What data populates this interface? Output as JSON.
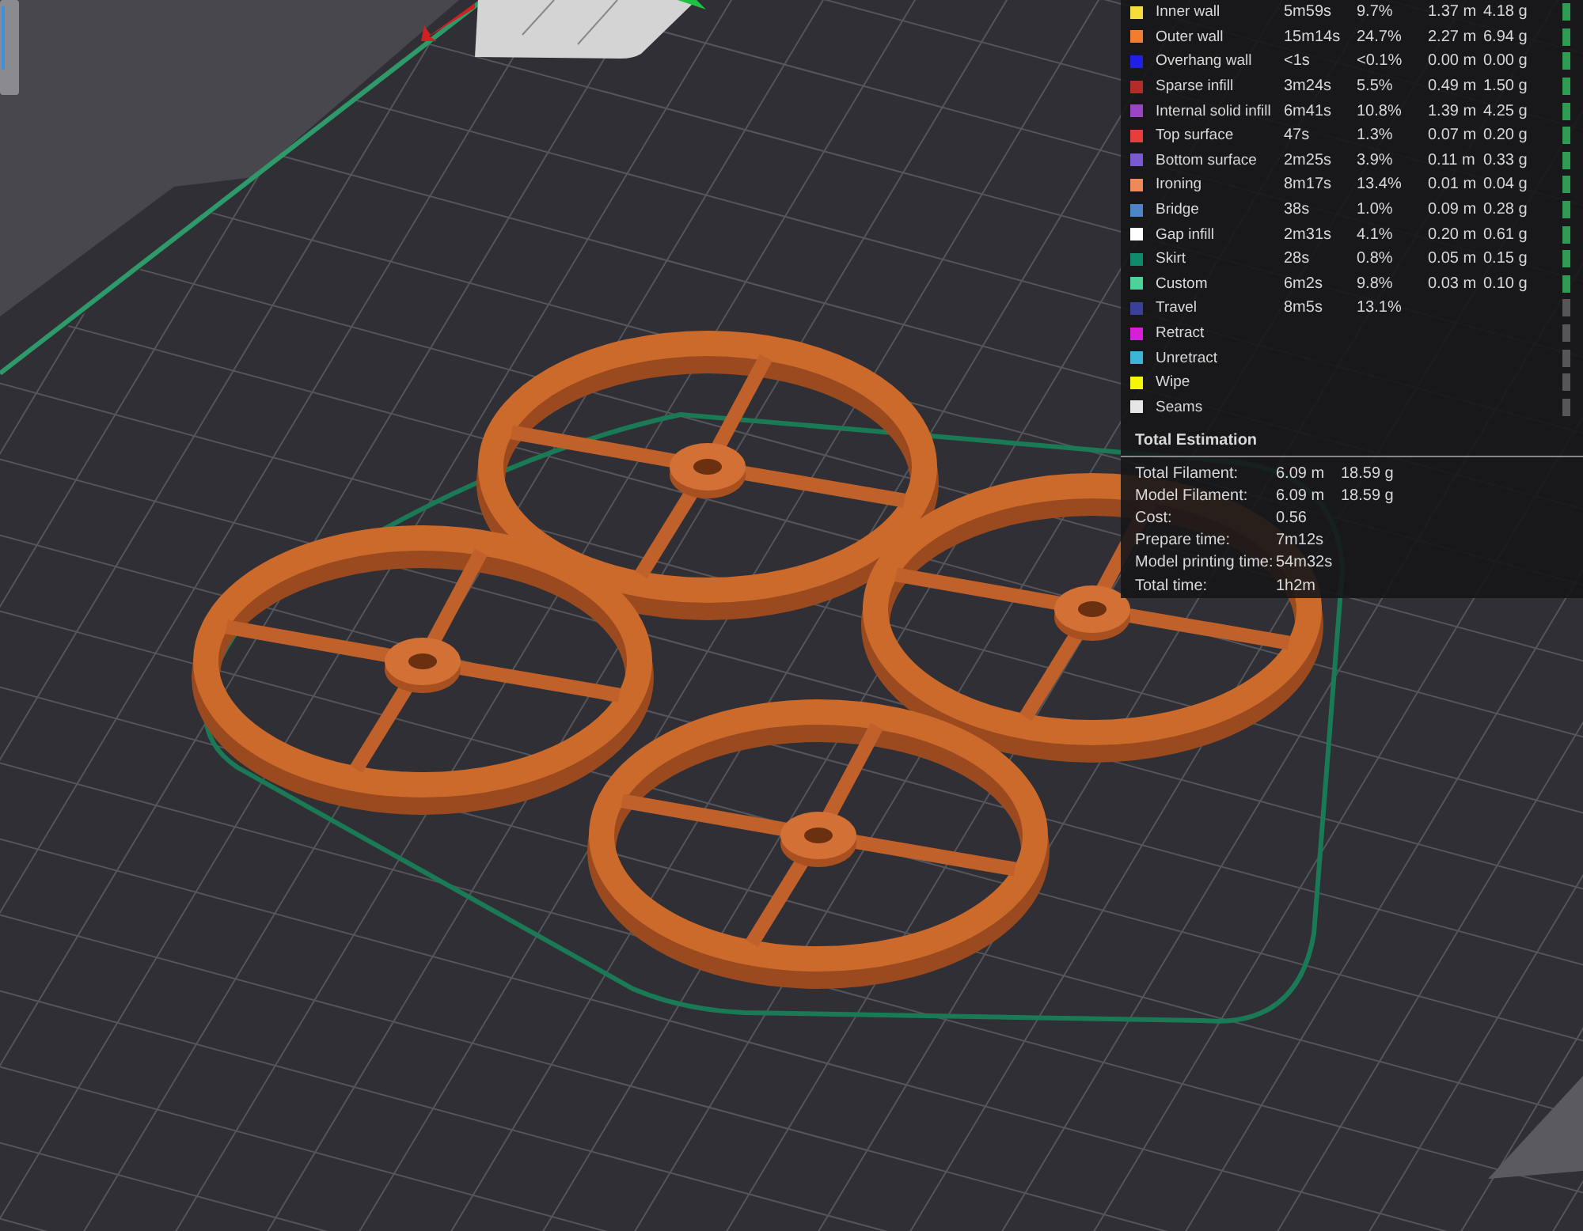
{
  "legend": {
    "rows": [
      {
        "name": "Inner wall",
        "color": "#f5dd3a",
        "time": "5m59s",
        "percent": "9.7%",
        "length": "1.37 m",
        "weight": "4.18 g",
        "checked": true
      },
      {
        "name": "Outer wall",
        "color": "#f07e30",
        "time": "15m14s",
        "percent": "24.7%",
        "length": "2.27 m",
        "weight": "6.94 g",
        "checked": true
      },
      {
        "name": "Overhang wall",
        "color": "#1f1fe8",
        "time": "<1s",
        "percent": "<0.1%",
        "length": "0.00 m",
        "weight": "0.00 g",
        "checked": true
      },
      {
        "name": "Sparse infill",
        "color": "#b02d2a",
        "time": "3m24s",
        "percent": "5.5%",
        "length": "0.49 m",
        "weight": "1.50 g",
        "checked": true
      },
      {
        "name": "Internal solid infill",
        "color": "#9b45c4",
        "time": "6m41s",
        "percent": "10.8%",
        "length": "1.39 m",
        "weight": "4.25 g",
        "checked": true
      },
      {
        "name": "Top surface",
        "color": "#e83d3d",
        "time": "47s",
        "percent": "1.3%",
        "length": "0.07 m",
        "weight": "0.20 g",
        "checked": true
      },
      {
        "name": "Bottom surface",
        "color": "#7a5ad2",
        "time": "2m25s",
        "percent": "3.9%",
        "length": "0.11 m",
        "weight": "0.33 g",
        "checked": true
      },
      {
        "name": "Ironing",
        "color": "#f0885a",
        "time": "8m17s",
        "percent": "13.4%",
        "length": "0.01 m",
        "weight": "0.04 g",
        "checked": true
      },
      {
        "name": "Bridge",
        "color": "#4d85c6",
        "time": "38s",
        "percent": "1.0%",
        "length": "0.09 m",
        "weight": "0.28 g",
        "checked": true
      },
      {
        "name": "Gap infill",
        "color": "#ffffff",
        "time": "2m31s",
        "percent": "4.1%",
        "length": "0.20 m",
        "weight": "0.61 g",
        "checked": true
      },
      {
        "name": "Skirt",
        "color": "#0f8a6a",
        "time": "28s",
        "percent": "0.8%",
        "length": "0.05 m",
        "weight": "0.15 g",
        "checked": true
      },
      {
        "name": "Custom",
        "color": "#4fd29a",
        "time": "6m2s",
        "percent": "9.8%",
        "length": "0.03 m",
        "weight": "0.10 g",
        "checked": true
      },
      {
        "name": "Travel",
        "color": "#3a3f9a",
        "time": "8m5s",
        "percent": "13.1%",
        "checked": false
      },
      {
        "name": "Retract",
        "color": "#d61fd6",
        "checked": false
      },
      {
        "name": "Unretract",
        "color": "#3fb4d6",
        "checked": false
      },
      {
        "name": "Wipe",
        "color": "#f5f50a",
        "checked": false
      },
      {
        "name": "Seams",
        "color": "#e6e6e6",
        "checked": false
      }
    ]
  },
  "total_estimation": {
    "title": "Total Estimation",
    "rows": [
      {
        "label": "Total Filament:",
        "value": "6.09 m",
        "value_2": "18.59 g"
      },
      {
        "label": "Model Filament:",
        "value": "6.09 m",
        "value_2": "18.59 g"
      },
      {
        "label": "Cost:",
        "value": "0.56"
      },
      {
        "label": "Prepare time:",
        "value": "7m12s"
      },
      {
        "label": "Model printing time:",
        "value": "54m32s"
      },
      {
        "label": "Total time:",
        "value": "1h2m"
      }
    ]
  }
}
